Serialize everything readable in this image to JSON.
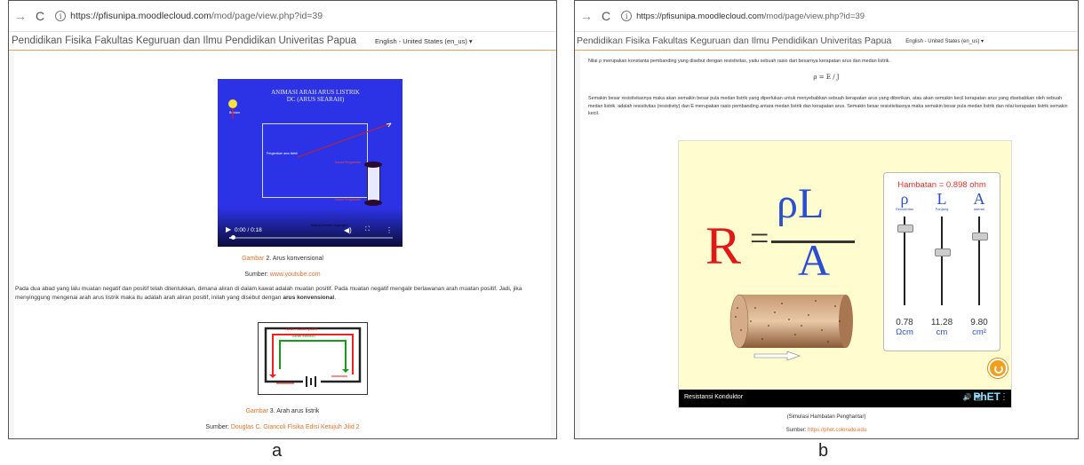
{
  "panel_a": {
    "browser": {
      "nav_arrow": "→",
      "reload": "C",
      "url_host": "https://pfisunipa.moodlecloud.com",
      "url_path": "/mod/page/view.php?id=39"
    },
    "header": {
      "title": "Pendidikan Fisika Fakultas Keguruan dan Ilmu Pendidikan Univeritas Papua",
      "language": "English - United States (en_us) ▾"
    },
    "video": {
      "title": "ANIMASI ARAH ARUS LISTRIK DC (ARUS SEARAH)",
      "time": "0:00 / 0:18",
      "progress": 0.02,
      "bulb_label": "Bohlam",
      "text_1": "Pergerakan arus listrik",
      "text_2": "Kawat Penghantar",
      "text_3": "Kawat Penghantar",
      "text_4": "Baterai (sumber tegangan)"
    },
    "fig2": {
      "prefix": "Gambar",
      "caption": " 2. Arus konvensional",
      "source_label": "Sumber: ",
      "source": "www.youtube.com"
    },
    "paragraph": {
      "text": "Pada dua abad yang lalu muatan negatif dan positif telah ditentukkan, dimana aliran di dalam kawat adalah muatan positif. Pada muatan negatif mengalir berlawanan arah muatan positif. Jadi, jika menyinggung mengenai arah arus listrik maka itu adalah arah aliran positif, inilah yang disebut dengan ",
      "bold": "arus konvensional",
      "end": "."
    },
    "circuit": {
      "label_red": "Aliran muatan positif",
      "label_green": "Aliran elektron"
    },
    "fig3": {
      "prefix": "Gambar",
      "caption": " 3. Arah arus listrik",
      "source_label": "Sumber: ",
      "source": "Douglas C. Giancoli Fisika Edisi Ketujuh Jilid 2"
    },
    "caption_letter": "a"
  },
  "panel_b": {
    "browser": {
      "nav_arrow": "→",
      "reload": "C",
      "url_host": "https://pfisunipa.moodlecloud.com",
      "url_path": "/mod/page/view.php?id=39"
    },
    "header": {
      "title": "Pendidikan Fisika Fakultas Keguruan dan Ilmu Pendidikan Univeritas Papua",
      "language": "English - United States (en_us) ▾"
    },
    "para_1": "Nilai ρ merupakan konstanta pembanding yang disebut dengan resistivitas, yaitu sebuah rasio dari besarnya kerapatan arus dan medan listrik.",
    "formula": "ρ = E / J",
    "para_2": "Semakin besar resistivitasnya maka akan semakin besar pula medan listrik yang diperlukan untuk menyebabkan sebuah kerapatan arus yang diberikan, atau akan semakin kecil kerapatan arus yang disebabkan oleh sebuah medan listrik. adalah resistivitas (resistivity) dan E merupakan rasio pembanding antara medan listrik dan kerapatan arus. Semakin besar resistivitasnya maka semakin besar pula medan listrik dan nilai kerapatan listrik semakin kecil.",
    "sim": {
      "R": "R",
      "eq": "=",
      "numerator": "ρL",
      "denominator": "A",
      "hambatan": "Hambatan = 0.898 ohm",
      "sliders": [
        {
          "symbol": "ρ",
          "name": "Resistivitas",
          "value": "0.78",
          "unit": "Ωcm",
          "level": 0.9
        },
        {
          "symbol": "L",
          "name": "Panjang",
          "value": "11.28",
          "unit": "cm",
          "level": 0.6
        },
        {
          "symbol": "A",
          "name": "daerah",
          "value": "9.80",
          "unit": "cm²",
          "level": 0.8
        }
      ],
      "title": "Resistansi Konduktor",
      "icons": "🔊 📷",
      "brand": "PhET",
      "menu": "⋮"
    },
    "caption": "(Simulasi Hambatan Penghantar)",
    "source_label": "Sumber: ",
    "source": "https://phet.colorado.edu",
    "caption_letter": "b"
  }
}
